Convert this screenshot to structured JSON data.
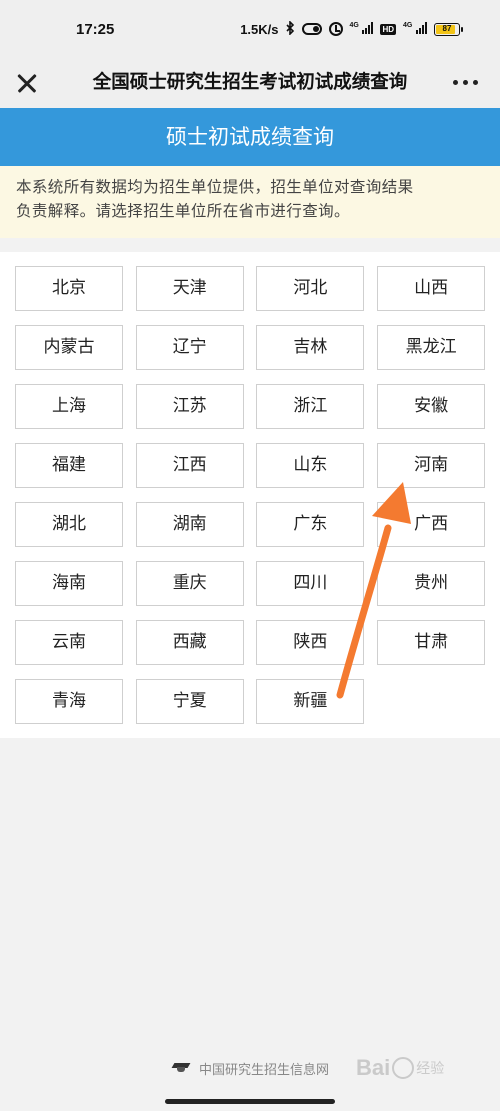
{
  "status_bar": {
    "time": "17:25",
    "net_speed": "1.5K/s",
    "network_tag_1": "4G",
    "hd_badge": "HD",
    "network_tag_2": "4G",
    "battery_level": 87,
    "battery_text": "87",
    "icons": [
      "bluetooth-icon",
      "toggle-icon",
      "alarm-icon",
      "signal-icon",
      "hd-icon",
      "signal-icon",
      "battery-icon"
    ]
  },
  "nav": {
    "title": "全国硕士研究生招生考试初试成绩查询",
    "close_icon": "close-icon",
    "more_icon": "more-icon"
  },
  "header": {
    "title": "硕士初试成绩查询",
    "background": "#3498db"
  },
  "notice": {
    "line1": "本系统所有数据均为招生单位提供，招生单位对查询结果",
    "line2": "负责解释。请选择招生单位所在省市进行查询。",
    "background": "#fcf8e3"
  },
  "provinces": [
    "北京",
    "天津",
    "河北",
    "山西",
    "内蒙古",
    "辽宁",
    "吉林",
    "黑龙江",
    "上海",
    "江苏",
    "浙江",
    "安徽",
    "福建",
    "江西",
    "山东",
    "河南",
    "湖北",
    "湖南",
    "广东",
    "广西",
    "海南",
    "重庆",
    "四川",
    "贵州",
    "云南",
    "西藏",
    "陕西",
    "甘肃",
    "青海",
    "宁夏",
    "新疆"
  ],
  "annotation": {
    "arrow_color": "#f47a30",
    "target": "河南"
  },
  "footer": {
    "text": "中国研究生招生信息网",
    "icon": "graduation-cap-icon"
  },
  "watermark": {
    "brand": "Bai",
    "brand2": "经验"
  }
}
